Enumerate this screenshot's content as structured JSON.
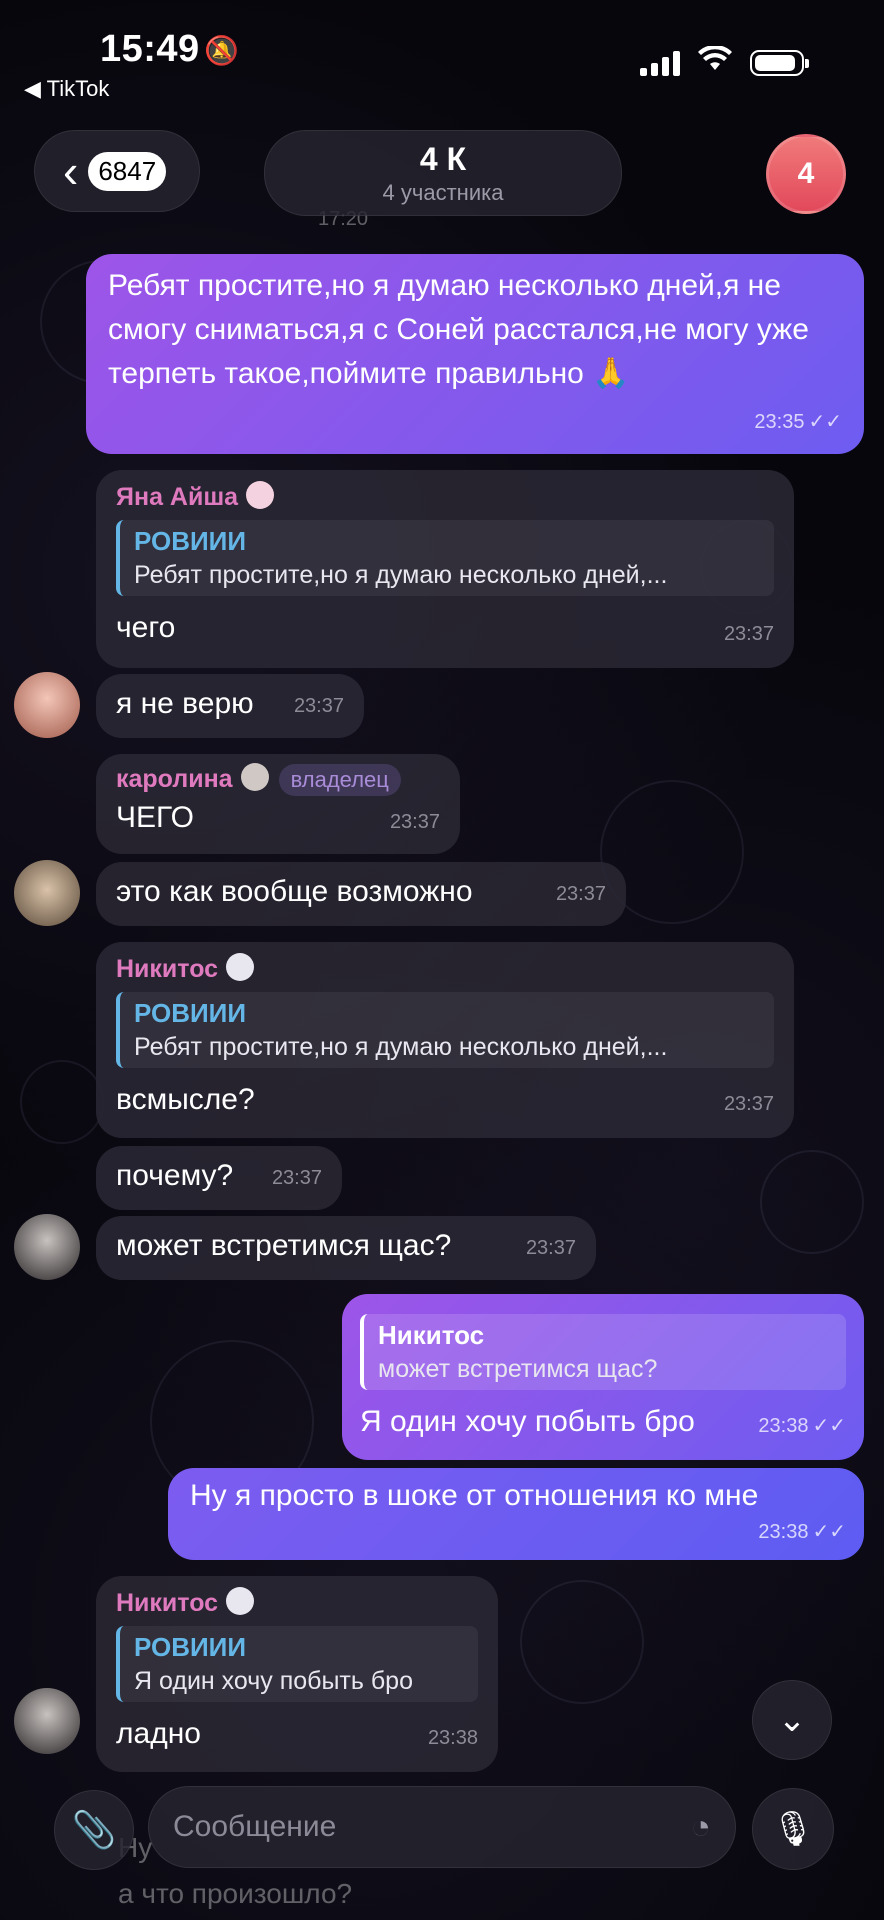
{
  "status_bar": {
    "time": "15:49",
    "back_app": "◀ TikTok"
  },
  "header": {
    "back_count": "6847",
    "title": "4 К",
    "subtitle": "4 участника",
    "avatar_text": "4",
    "ghost_top": "17:20"
  },
  "messages": [
    {
      "text": "Ребят простите,но я думаю несколько дней,я не смогу сниматься,я с Соней расстался,не могу уже терпеть такое,поймите правильно 🙏",
      "time": "23:35"
    },
    {
      "sender": "Яна Айша",
      "reply_name": "РОВИИИ",
      "reply_text": "Ребят простите,но я думаю несколько дней,...",
      "text": "чего",
      "time": "23:37"
    },
    {
      "text": "я не верю",
      "time": "23:37"
    },
    {
      "sender": "каролина",
      "role": "владелец",
      "text": "ЧЕГО",
      "time": "23:37"
    },
    {
      "text": "это как вообще возможно",
      "time": "23:37"
    },
    {
      "sender": "Никитос",
      "reply_name": "РОВИИИ",
      "reply_text": "Ребят простите,но я думаю несколько дней,...",
      "text": "всмысле?",
      "time": "23:37"
    },
    {
      "text": "почему?",
      "time": "23:37"
    },
    {
      "text": "может встретимся щас?",
      "time": "23:37"
    },
    {
      "reply_name": "Никитос",
      "reply_text": "может встретимся щас?",
      "text": "Я один хочу побыть бро",
      "time": "23:38"
    },
    {
      "text": "Ну я просто в шоке от отношения ко мне",
      "time": "23:38"
    },
    {
      "sender": "Никитос",
      "reply_name": "РОВИИИ",
      "reply_text": "Я один хочу побыть бро",
      "text": "ладно",
      "time": "23:38"
    }
  ],
  "input": {
    "placeholder": "Сообщение"
  },
  "ghost_bottom": "а что произошло?",
  "ghost_bottom2": "Ну"
}
